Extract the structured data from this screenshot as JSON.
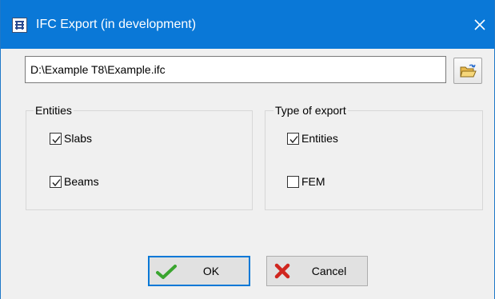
{
  "window": {
    "title": "IFC Export (in development)",
    "icon": "app-structure-icon",
    "close_icon": "close-icon"
  },
  "file": {
    "path": "D:\\Example T8\\Example.ifc",
    "browse_icon": "open-folder-icon"
  },
  "entities_group": {
    "label": "Entities",
    "items": [
      {
        "label": "Slabs",
        "checked": true
      },
      {
        "label": "Beams",
        "checked": true
      }
    ]
  },
  "export_type_group": {
    "label": "Type of export",
    "items": [
      {
        "label": "Entities",
        "checked": true
      },
      {
        "label": "FEM",
        "checked": false
      }
    ]
  },
  "buttons": {
    "ok_label": "OK",
    "ok_icon": "green-checkmark-icon",
    "cancel_label": "Cancel",
    "cancel_icon": "red-x-icon"
  },
  "colors": {
    "titlebar": "#0a78d7",
    "focus_border": "#0078d7",
    "ok_icon": "#3aa52f",
    "cancel_icon": "#d0261f"
  }
}
